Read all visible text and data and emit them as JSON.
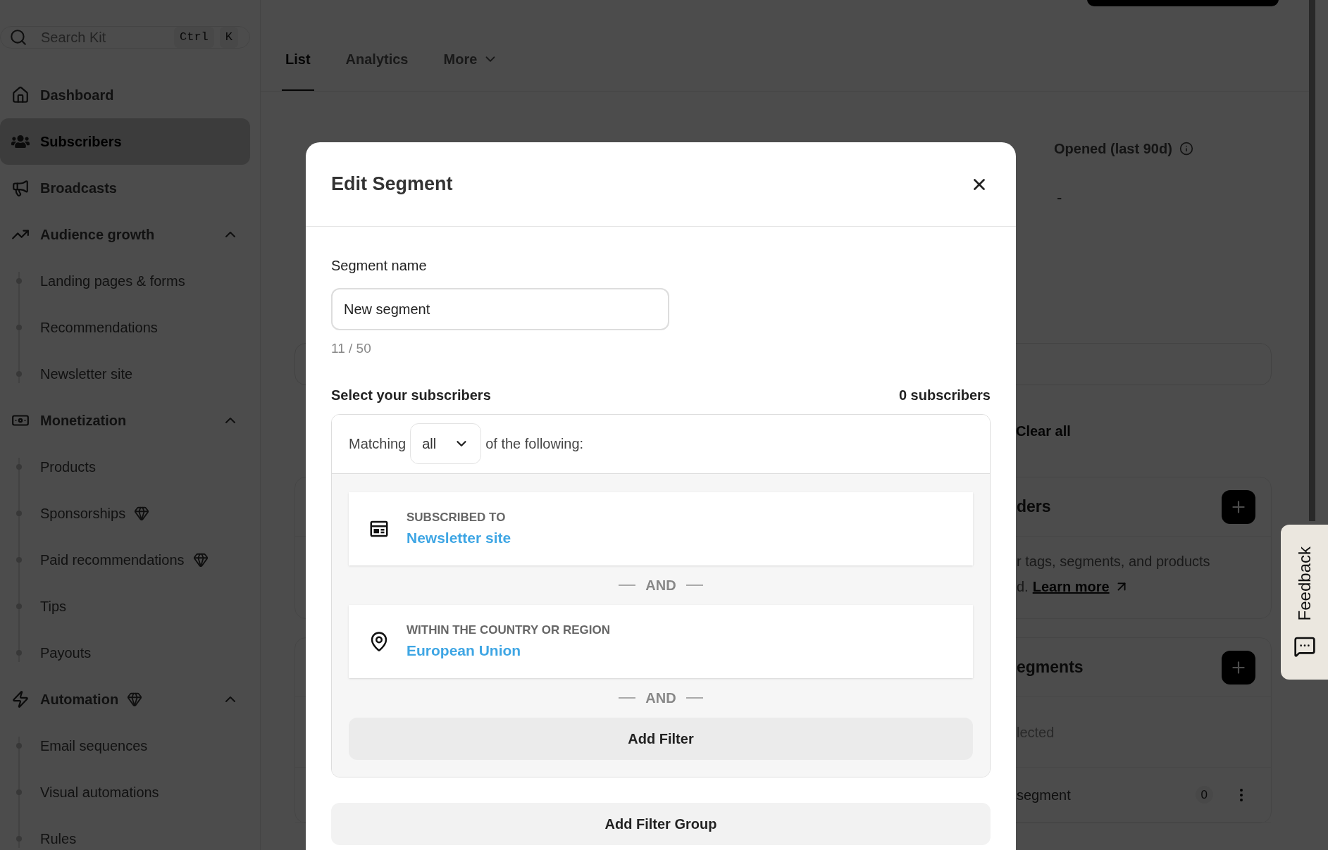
{
  "sidebar": {
    "search": {
      "placeholder": "Search Kit",
      "keys": [
        "Ctrl",
        "K"
      ]
    },
    "items": [
      {
        "label": "Dashboard",
        "selected": false,
        "premium": false
      },
      {
        "label": "Subscribers",
        "selected": true,
        "premium": false
      },
      {
        "label": "Broadcasts",
        "selected": false,
        "premium": false
      },
      {
        "label": "Audience growth",
        "selected": false,
        "premium": false,
        "expanded": true,
        "children": [
          {
            "label": "Landing pages & forms",
            "selected": false,
            "premium": false
          },
          {
            "label": "Recommendations",
            "selected": false,
            "premium": false
          },
          {
            "label": "Newsletter site",
            "selected": false,
            "premium": false
          }
        ]
      },
      {
        "label": "Monetization",
        "selected": false,
        "premium": false,
        "expanded": true,
        "children": [
          {
            "label": "Products",
            "selected": false,
            "premium": false
          },
          {
            "label": "Sponsorships",
            "selected": false,
            "premium": true
          },
          {
            "label": "Paid recommendations",
            "selected": false,
            "premium": true
          },
          {
            "label": "Tips",
            "selected": false,
            "premium": false
          },
          {
            "label": "Payouts",
            "selected": false,
            "premium": false
          }
        ]
      },
      {
        "label": "Automation",
        "selected": false,
        "premium": true,
        "expanded": true,
        "children": [
          {
            "label": "Email sequences",
            "selected": false,
            "premium": false
          },
          {
            "label": "Visual automations",
            "selected": false,
            "premium": false
          },
          {
            "label": "Rules",
            "selected": false,
            "premium": false
          }
        ]
      }
    ]
  },
  "tabs": [
    {
      "label": "List",
      "selected": true,
      "has_menu": false
    },
    {
      "label": "Analytics",
      "selected": false,
      "has_menu": false
    },
    {
      "label": "More",
      "selected": false,
      "has_menu": true
    }
  ],
  "stats": [
    {
      "label": "Opened (last 90d)",
      "value": "-"
    }
  ],
  "filters": {
    "clear": "Clear all"
  },
  "cards": [
    {
      "title": "ders",
      "lines": [
        "r tags, segments, and products",
        "d."
      ],
      "link": "Learn more"
    },
    {
      "title": "egments",
      "note": "lected",
      "rows": [
        {
          "name": "segment",
          "count": "0"
        }
      ]
    }
  ],
  "feedback": {
    "label": "Feedback"
  },
  "modal": {
    "title": "Edit Segment",
    "name_field": {
      "label": "Segment name",
      "value": "New segment",
      "counter": "11 / 50"
    },
    "selection": {
      "label": "Select your subscribers",
      "count": "0 subscribers",
      "match_prefix": "Matching",
      "match_value": "all",
      "match_suffix": "of the following:",
      "filters": [
        {
          "kind": "newsletter",
          "label": "SUBSCRIBED TO",
          "value": "Newsletter site",
          "joiner": "AND"
        },
        {
          "kind": "location",
          "label": "WITHIN THE COUNTRY OR REGION",
          "value": "European Union",
          "joiner": "AND"
        }
      ],
      "add_filter": "Add Filter"
    },
    "add_group": "Add Filter Group"
  }
}
